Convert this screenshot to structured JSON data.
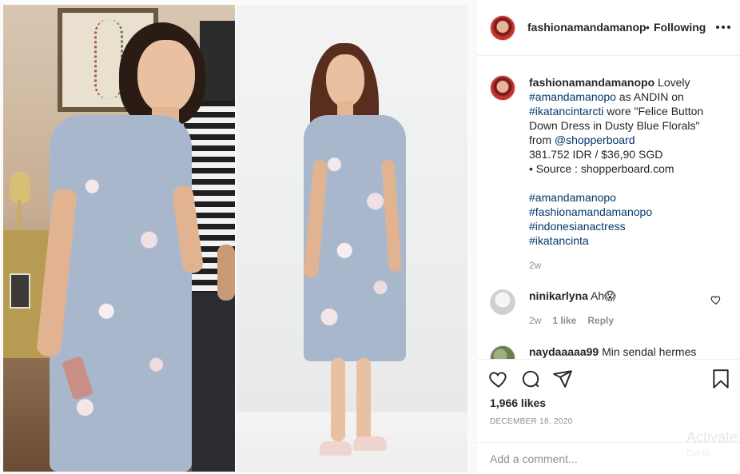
{
  "post": {
    "username": "fashionamandamanop",
    "separator": "•",
    "follow_status": "Following",
    "more_icon": "more-horizontal-icon"
  },
  "caption": {
    "username": "fashionamandamanopo",
    "t1": " Lovely ",
    "mention1": "#amandamanopo",
    "t2": " as ANDIN on ",
    "tag1": "#ikatancintarcti",
    "t3": " wore \"Felice Button Down Dress in Dusty Blue Florals\" from ",
    "mention2": "@shopperboard",
    "price": "381.752 IDR / $36,90 SGD",
    "source": "• Source : shopperboard.com",
    "hashtags": [
      "#amandamanopo",
      "#fashionamandamanopo",
      "#indonesianactress",
      "#ikatancinta"
    ],
    "time": "2w"
  },
  "comments": [
    {
      "username": "ninikarlyna",
      "text": " Ah😱",
      "time": "2w",
      "likes": "1 like",
      "reply": "Reply"
    },
    {
      "username": "naydaaaaa99",
      "text": " Min sendal hermes"
    }
  ],
  "actions": {
    "like_icon": "heart-icon",
    "comment_icon": "comment-icon",
    "share_icon": "send-icon",
    "save_icon": "bookmark-icon",
    "likes": "1,966 likes",
    "date": "DECEMBER 18, 2020",
    "comment_placeholder": "Add a comment...",
    "watermark_line1": "Activate",
    "watermark_line2": "Go to"
  },
  "colors": {
    "link": "#00376b",
    "muted": "#8e8e8e",
    "text": "#262626",
    "border": "#efefef"
  }
}
